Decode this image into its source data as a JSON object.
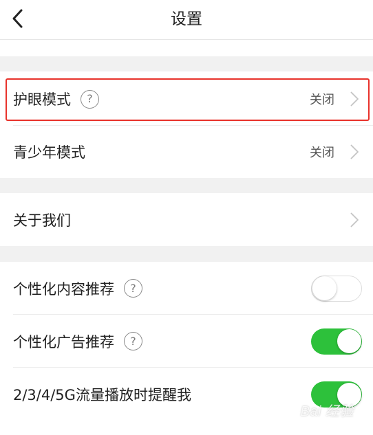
{
  "header": {
    "title": "设置"
  },
  "eye_care": {
    "label": "护眼模式",
    "value": "关闭"
  },
  "teen_mode": {
    "label": "青少年模式",
    "value": "关闭"
  },
  "about": {
    "label": "关于我们"
  },
  "personalized_content": {
    "label": "个性化内容推荐",
    "enabled": false
  },
  "personalized_ads": {
    "label": "个性化广告推荐",
    "enabled": true
  },
  "data_reminder": {
    "label": "2/3/4/5G流量播放时提醒我",
    "enabled": true
  },
  "help_symbol": "?",
  "watermark": "Bai 经验",
  "colors": {
    "toggle_on": "#2dc13b",
    "highlight": "#e8322b",
    "section_gap": "#f1f1f1"
  }
}
